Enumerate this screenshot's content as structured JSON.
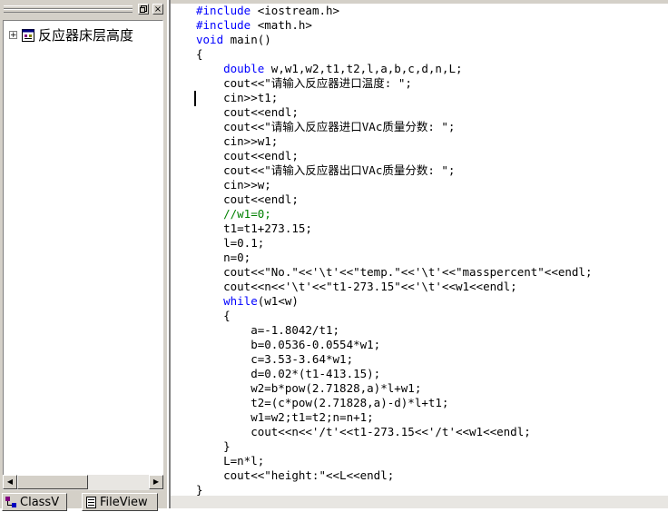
{
  "class_view": {
    "close_glyph": "×",
    "tree_item": {
      "expander": "+",
      "label": "反应器床层高度"
    },
    "tabs": [
      {
        "label": "ClassV",
        "icon": "class-view-icon"
      },
      {
        "label": "FileView",
        "icon": "file-view-icon"
      }
    ]
  },
  "editor": {
    "lines": [
      [
        {
          "t": "#include",
          "c": "kw"
        },
        {
          "t": " <iostream.h>",
          "c": ""
        }
      ],
      [
        {
          "t": "#include",
          "c": "kw"
        },
        {
          "t": " <math.h>",
          "c": ""
        }
      ],
      [
        {
          "t": "void",
          "c": "kw"
        },
        {
          "t": " main()",
          "c": ""
        }
      ],
      [
        {
          "t": "{",
          "c": ""
        }
      ],
      [
        {
          "t": "    ",
          "c": ""
        },
        {
          "t": "double",
          "c": "kw"
        },
        {
          "t": " w,w1,w2,t1,t2,l,a,b,c,d,n,L;",
          "c": ""
        }
      ],
      [
        {
          "t": "    cout<<\"请输入反应器进口温度: \";",
          "c": ""
        }
      ],
      [
        {
          "t": "    cin>>t1;",
          "c": ""
        }
      ],
      [
        {
          "t": "    cout<<endl;",
          "c": ""
        }
      ],
      [
        {
          "t": "    cout<<\"请输入反应器进口VAc质量分数: \";",
          "c": ""
        }
      ],
      [
        {
          "t": "    cin>>w1;",
          "c": ""
        }
      ],
      [
        {
          "t": "    cout<<endl;",
          "c": ""
        }
      ],
      [
        {
          "t": "    cout<<\"请输入反应器出口VAc质量分数: \";",
          "c": ""
        }
      ],
      [
        {
          "t": "    cin>>w;",
          "c": ""
        }
      ],
      [
        {
          "t": "    cout<<endl;",
          "c": ""
        }
      ],
      [
        {
          "t": "    ",
          "c": ""
        },
        {
          "t": "//w1=0;",
          "c": "cm"
        }
      ],
      [
        {
          "t": "    t1=t1+273.15;",
          "c": ""
        }
      ],
      [
        {
          "t": "    l=0.1;",
          "c": ""
        }
      ],
      [
        {
          "t": "    n=0;",
          "c": ""
        }
      ],
      [
        {
          "t": "    cout<<\"No.\"<<'\\t'<<\"temp.\"<<'\\t'<<\"masspercent\"<<endl;",
          "c": ""
        }
      ],
      [
        {
          "t": "    cout<<n<<'\\t'<<\"t1-273.15\"<<'\\t'<<w1<<endl;",
          "c": ""
        }
      ],
      [
        {
          "t": "    ",
          "c": ""
        },
        {
          "t": "while",
          "c": "kw"
        },
        {
          "t": "(w1<w)",
          "c": ""
        }
      ],
      [
        {
          "t": "    {",
          "c": ""
        }
      ],
      [
        {
          "t": "        a=-1.8042/t1;",
          "c": ""
        }
      ],
      [
        {
          "t": "        b=0.0536-0.0554*w1;",
          "c": ""
        }
      ],
      [
        {
          "t": "        c=3.53-3.64*w1;",
          "c": ""
        }
      ],
      [
        {
          "t": "        d=0.02*(t1-413.15);",
          "c": ""
        }
      ],
      [
        {
          "t": "        w2=b*pow(2.71828,a)*l+w1;",
          "c": ""
        }
      ],
      [
        {
          "t": "        t2=(c*pow(2.71828,a)-d)*l+t1;",
          "c": ""
        }
      ],
      [
        {
          "t": "        w1=w2;t1=t2;n=n+1;",
          "c": ""
        }
      ],
      [
        {
          "t": "        cout<<n<<'/t'<<t1-273.15<<'/t'<<w1<<endl;",
          "c": ""
        }
      ],
      [
        {
          "t": "    }",
          "c": ""
        }
      ],
      [
        {
          "t": "    L=n*l;",
          "c": ""
        }
      ],
      [
        {
          "t": "    cout<<\"height:\"<<L<<endl;",
          "c": ""
        }
      ],
      [
        {
          "t": "}",
          "c": ""
        }
      ]
    ]
  }
}
